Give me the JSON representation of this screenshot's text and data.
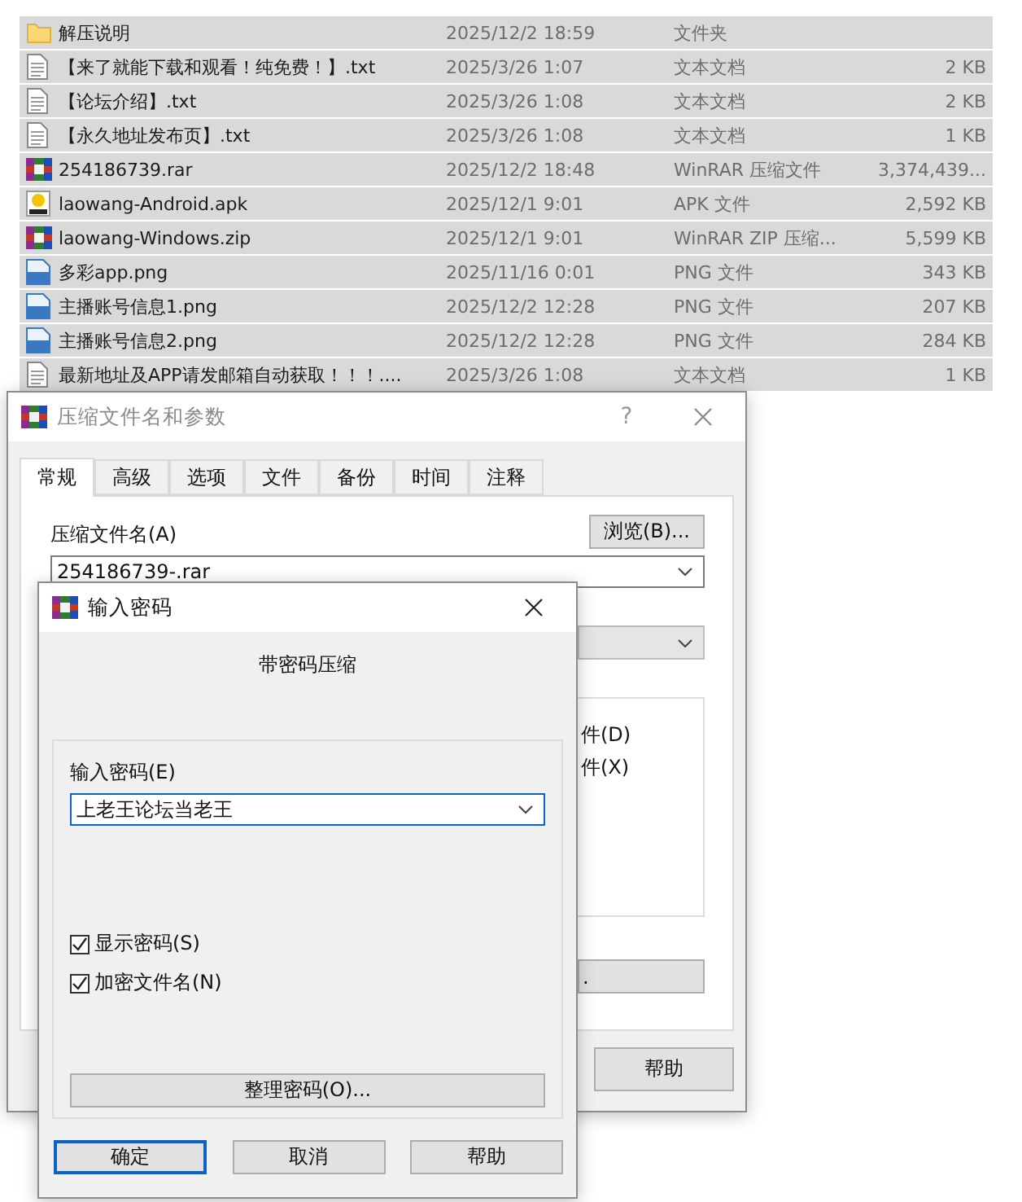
{
  "files": [
    {
      "name": "解压说明",
      "date": "2025/12/2 18:59",
      "type": "文件夹",
      "kind": "folder",
      "selected": true
    },
    {
      "name": "【来了就能下载和观看！纯免费！】.txt",
      "date": "2025/3/26 1:07",
      "type": "文本文档",
      "size": "2 KB",
      "kind": "text",
      "selected": true
    },
    {
      "name": "【论坛介绍】.txt",
      "date": "2025/3/26 1:08",
      "type": "文本文档",
      "size": "2 KB",
      "kind": "text",
      "selected": true
    },
    {
      "name": "【永久地址发布页】.txt",
      "date": "2025/3/26 1:08",
      "type": "文本文档",
      "size": "1 KB",
      "kind": "text",
      "selected": true
    },
    {
      "name": "254186739.rar",
      "date": "2025/12/2 18:48",
      "type": "WinRAR 压缩文件",
      "size": "3,374,439...",
      "kind": "archive",
      "selected": true
    },
    {
      "name": "laowang-Android.apk",
      "date": "2025/12/1 9:01",
      "type": "APK 文件",
      "size": "2,592 KB",
      "kind": "apk",
      "selected": true
    },
    {
      "name": "laowang-Windows.zip",
      "date": "2025/12/1 9:01",
      "type": "WinRAR ZIP 压缩...",
      "size": "5,599 KB",
      "kind": "archive",
      "selected": true
    },
    {
      "name": "多彩app.png",
      "date": "2025/11/16 0:01",
      "type": "PNG 文件",
      "size": "343 KB",
      "kind": "image",
      "selected": true
    },
    {
      "name": "主播账号信息1.png",
      "date": "2025/12/2 12:28",
      "type": "PNG 文件",
      "size": "207 KB",
      "kind": "image",
      "selected": true
    },
    {
      "name": "主播账号信息2.png",
      "date": "2025/12/2 12:28",
      "type": "PNG 文件",
      "size": "284 KB",
      "kind": "image",
      "selected": true
    },
    {
      "name": "最新地址及APP请发邮箱自动获取！！！....",
      "date": "2025/3/26 1:08",
      "type": "文本文档",
      "size": "1 KB",
      "kind": "text",
      "selected": true
    }
  ],
  "archive_dialog": {
    "title": "压缩文件名和参数",
    "help_glyph": "?",
    "tabs": [
      {
        "label": "常规",
        "selected": true
      },
      {
        "label": "高级",
        "selected": false
      },
      {
        "label": "选项",
        "selected": false
      },
      {
        "label": "文件",
        "selected": false
      },
      {
        "label": "备份",
        "selected": false
      },
      {
        "label": "时间",
        "selected": false
      },
      {
        "label": "注释",
        "selected": false
      }
    ],
    "archive_name_label": "压缩文件名(A)",
    "archive_name_value": "254186739-.rar",
    "browse_button": "浏览(B)...",
    "option_texts": [
      "件(D)",
      "件(X)"
    ],
    "partial_button": ".",
    "help_button": "帮助"
  },
  "password_dialog": {
    "title": "输入密码",
    "heading": "带密码压缩",
    "password_label": "输入密码(E)",
    "password_value": "上老王论坛当老王",
    "checkboxes": [
      {
        "label": "显示密码(S)",
        "checked": true
      },
      {
        "label": "加密文件名(N)",
        "checked": true
      }
    ],
    "organize_button": "整理密码(O)...",
    "buttons": [
      {
        "label": "确定",
        "default": true
      },
      {
        "label": "取消",
        "default": false
      },
      {
        "label": "帮助",
        "default": false
      }
    ]
  }
}
